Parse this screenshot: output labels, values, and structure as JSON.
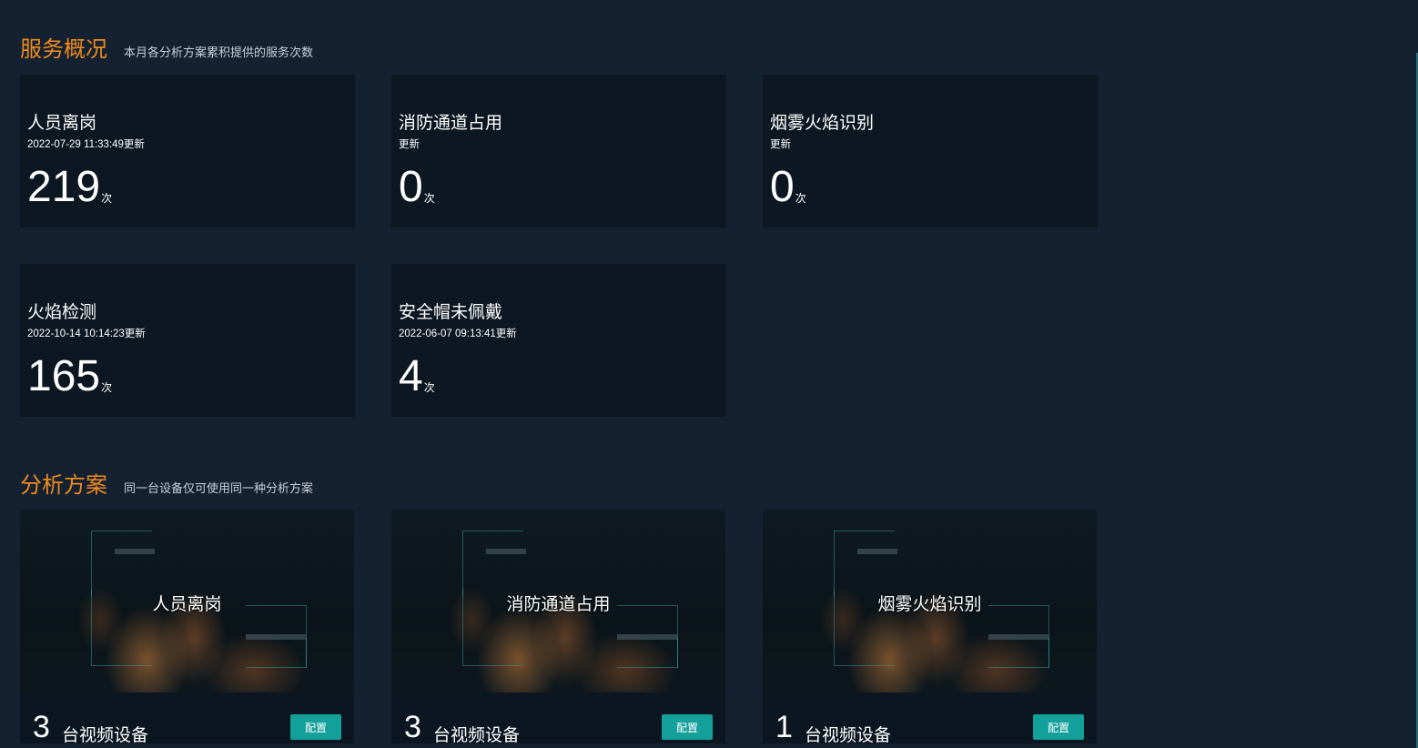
{
  "overview": {
    "title": "服务概况",
    "subtitle": "本月各分析方案累积提供的服务次数",
    "cards": [
      {
        "name": "人员离岗",
        "time": "2022-07-29 11:33:49更新",
        "count": "219",
        "unit": "次"
      },
      {
        "name": "消防通道占用",
        "time": "更新",
        "count": "0",
        "unit": "次"
      },
      {
        "name": "烟雾火焰识别",
        "time": "更新",
        "count": "0",
        "unit": "次"
      },
      {
        "name": "火焰检测",
        "time": "2022-10-14 10:14:23更新",
        "count": "165",
        "unit": "次"
      },
      {
        "name": "安全帽未佩戴",
        "time": "2022-06-07 09:13:41更新",
        "count": "4",
        "unit": "次"
      }
    ]
  },
  "plans": {
    "title": "分析方案",
    "subtitle": "同一台设备仅可使用同一种分析方案",
    "items": [
      {
        "name": "人员离岗",
        "count": "3",
        "count_label": "台视频设备",
        "button": "配置"
      },
      {
        "name": "消防通道占用",
        "count": "3",
        "count_label": "台视频设备",
        "button": "配置"
      },
      {
        "name": "烟雾火焰识别",
        "count": "1",
        "count_label": "台视频设备",
        "button": "配置"
      }
    ]
  },
  "colors": {
    "background": "#132131",
    "card": "#0d1721",
    "accent_title": "#f08a1e",
    "button": "#14a09a"
  }
}
